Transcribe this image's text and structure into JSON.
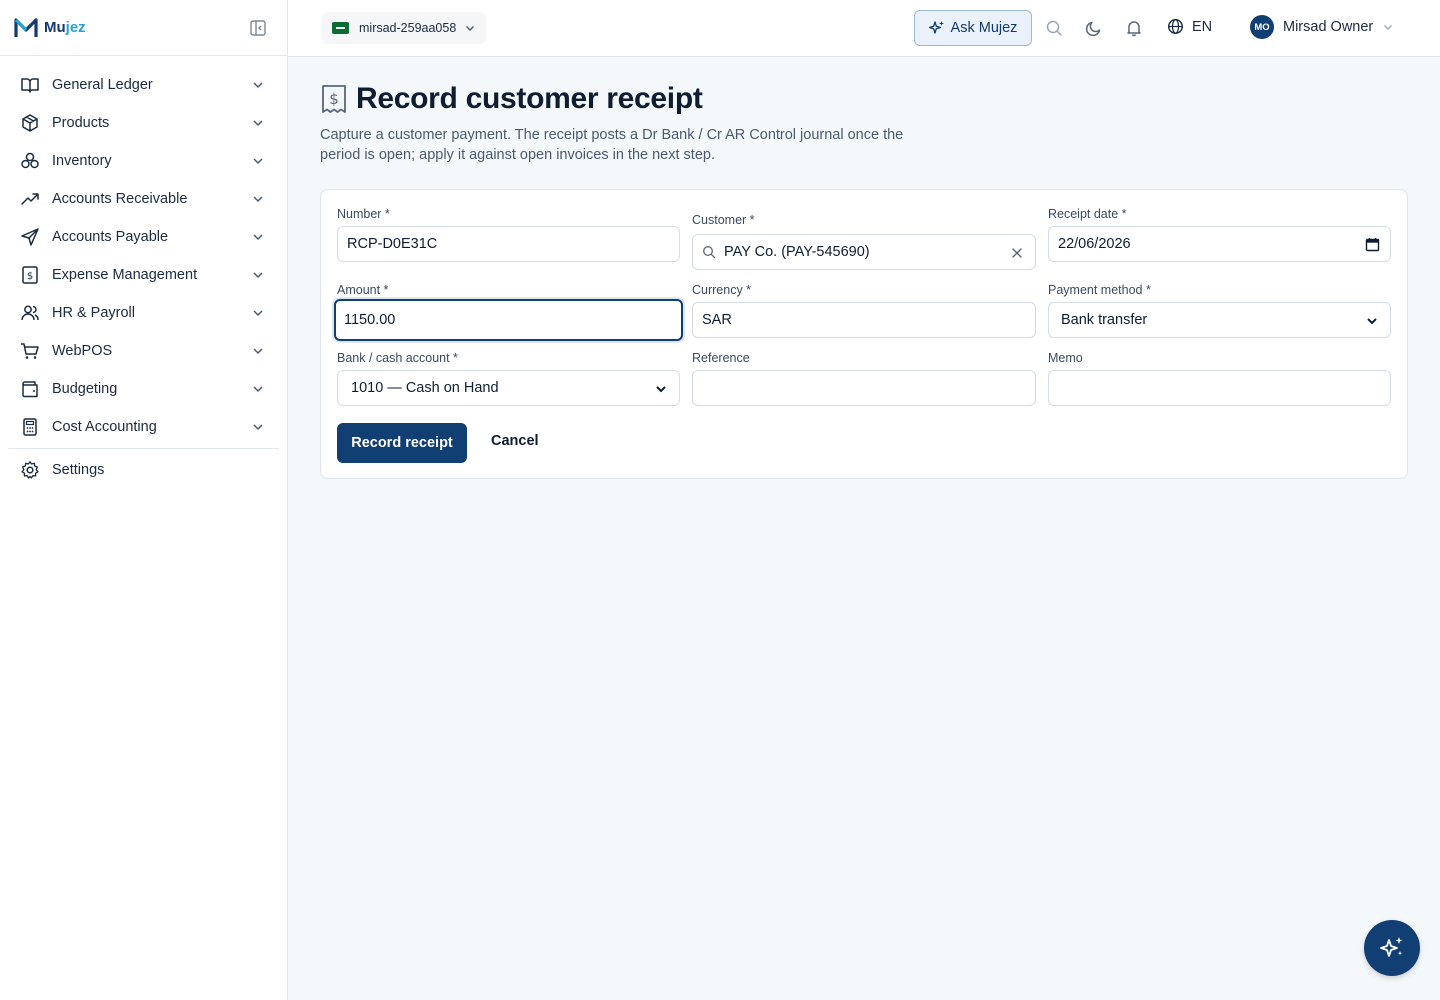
{
  "brand": {
    "name_part1": "Mu",
    "name_part2": "jez"
  },
  "sidebar": {
    "items": [
      {
        "label": "General Ledger",
        "icon": "book-icon"
      },
      {
        "label": "Products",
        "icon": "package-icon"
      },
      {
        "label": "Inventory",
        "icon": "boxes-icon"
      },
      {
        "label": "Accounts Receivable",
        "icon": "trend-up-icon"
      },
      {
        "label": "Accounts Payable",
        "icon": "send-icon"
      },
      {
        "label": "Expense Management",
        "icon": "receipt-icon"
      },
      {
        "label": "HR & Payroll",
        "icon": "users-icon"
      },
      {
        "label": "WebPOS",
        "icon": "cart-icon"
      },
      {
        "label": "Budgeting",
        "icon": "wallet-icon"
      },
      {
        "label": "Cost Accounting",
        "icon": "calculator-icon"
      }
    ],
    "settings_label": "Settings"
  },
  "topbar": {
    "org_name": "mirsad-259aa058",
    "ask_label": "Ask Mujez",
    "lang_label": "EN",
    "user_initials": "MO",
    "user_name": "Mirsad Owner"
  },
  "page": {
    "title": "Record customer receipt",
    "description": "Capture a customer payment. The receipt posts a Dr Bank / Cr AR Control journal once the period is open; apply it against open invoices in the next step."
  },
  "form": {
    "number_label": "Number *",
    "number_value": "RCP-D0E31C",
    "customer_label": "Customer *",
    "customer_value": "PAY Co. (PAY-545690)",
    "receipt_date_label": "Receipt date *",
    "receipt_date_value": "22/06/2026",
    "amount_label": "Amount *",
    "amount_value": "1150.00",
    "currency_label": "Currency *",
    "currency_value": "SAR",
    "payment_method_label": "Payment method *",
    "payment_method_value": "Bank transfer",
    "bank_account_label": "Bank / cash account *",
    "bank_account_value": "1010 — Cash on Hand",
    "reference_label": "Reference",
    "reference_value": "",
    "memo_label": "Memo",
    "memo_value": "",
    "submit_label": "Record receipt",
    "cancel_label": "Cancel"
  },
  "colors": {
    "primary": "#123f73",
    "accent": "#2aa0d8",
    "background": "#f5f8fb",
    "border": "#d6dde6"
  }
}
